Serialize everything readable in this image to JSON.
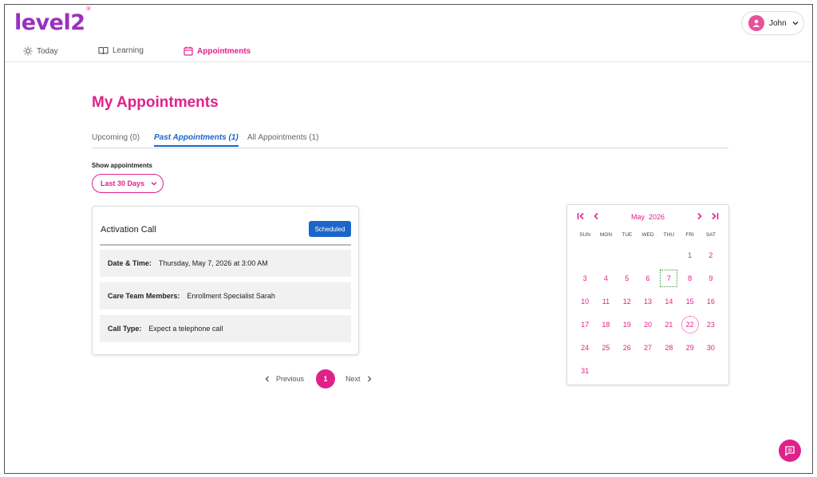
{
  "brand": {
    "name": "level2",
    "mark": "®"
  },
  "user": {
    "name": "John"
  },
  "nav": [
    {
      "label": "Today",
      "icon": "sun-icon"
    },
    {
      "label": "Learning",
      "icon": "book-icon"
    },
    {
      "label": "Appointments",
      "icon": "calendar-icon",
      "active": true
    }
  ],
  "page": {
    "title": "My Appointments"
  },
  "tabs": [
    {
      "label": "Upcoming (0)"
    },
    {
      "label": "Past Appointments (1)",
      "active": true
    },
    {
      "label": "All Appointments (1)"
    }
  ],
  "filter": {
    "label": "Show appointments",
    "value": "Last 30 Days"
  },
  "appointment": {
    "title": "Activation Call",
    "status": "Scheduled",
    "fields": [
      {
        "key": "Date & Time:",
        "value": "Thursday, May 7, 2026 at 3:00 AM"
      },
      {
        "key": "Care Team Members:",
        "value": "Enrollment Specialist Sarah"
      },
      {
        "key": "Call Type:",
        "value": "Expect a telephone call"
      }
    ]
  },
  "pagination": {
    "prev": "Previous",
    "current": "1",
    "next": "Next"
  },
  "calendar": {
    "month": "May",
    "year": "2026",
    "weekdays": [
      "SUN",
      "MON",
      "TUE",
      "WED",
      "THU",
      "FRI",
      "SAT"
    ],
    "first_weekday_index": 5,
    "days_in_month": 31,
    "today": 7,
    "selected": 22
  },
  "colors": {
    "accent": "#e0218a",
    "brand": "#9b2fbf",
    "primary": "#1a66c9"
  }
}
